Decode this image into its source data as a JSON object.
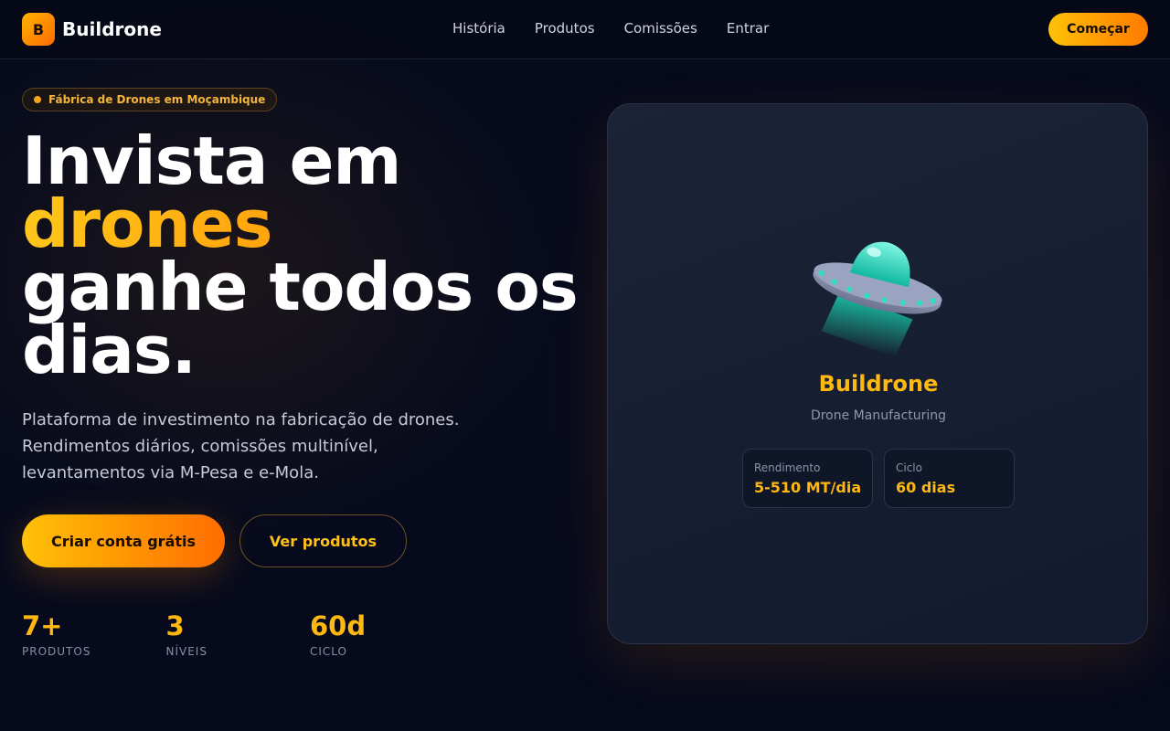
{
  "header": {
    "logo_letter": "B",
    "brand": "Buildrone",
    "nav": [
      "História",
      "Produtos",
      "Comissões",
      "Entrar"
    ],
    "cta": "Começar"
  },
  "hero": {
    "badge": "Fábrica de Drones em Moçambique",
    "headline": {
      "line1": "Invista em",
      "accent": "drones",
      "line3": "ganhe todos os",
      "line4": "dias."
    },
    "description": "Plataforma de investimento na fabricação de drones. Rendimentos diários, comissões multinível, levantamentos via M-Pesa e e-Mola.",
    "primary_button": "Criar conta grátis",
    "secondary_button": "Ver produtos",
    "stats": [
      {
        "value": "7+",
        "label": "PRODUTOS"
      },
      {
        "value": "3",
        "label": "NÍVEIS"
      },
      {
        "value": "60d",
        "label": "CICLO"
      }
    ]
  },
  "card": {
    "icon": "ufo-icon",
    "title": "Buildrone",
    "subtitle": "Drone Manufacturing",
    "metrics": [
      {
        "label": "Rendimento",
        "value": "5-510 MT/dia"
      },
      {
        "label": "Ciclo",
        "value": "60 dias"
      }
    ]
  },
  "colors": {
    "accent": "#ffb80f",
    "accent_gradient_end": "#ff6d00",
    "background": "#060a1c"
  }
}
